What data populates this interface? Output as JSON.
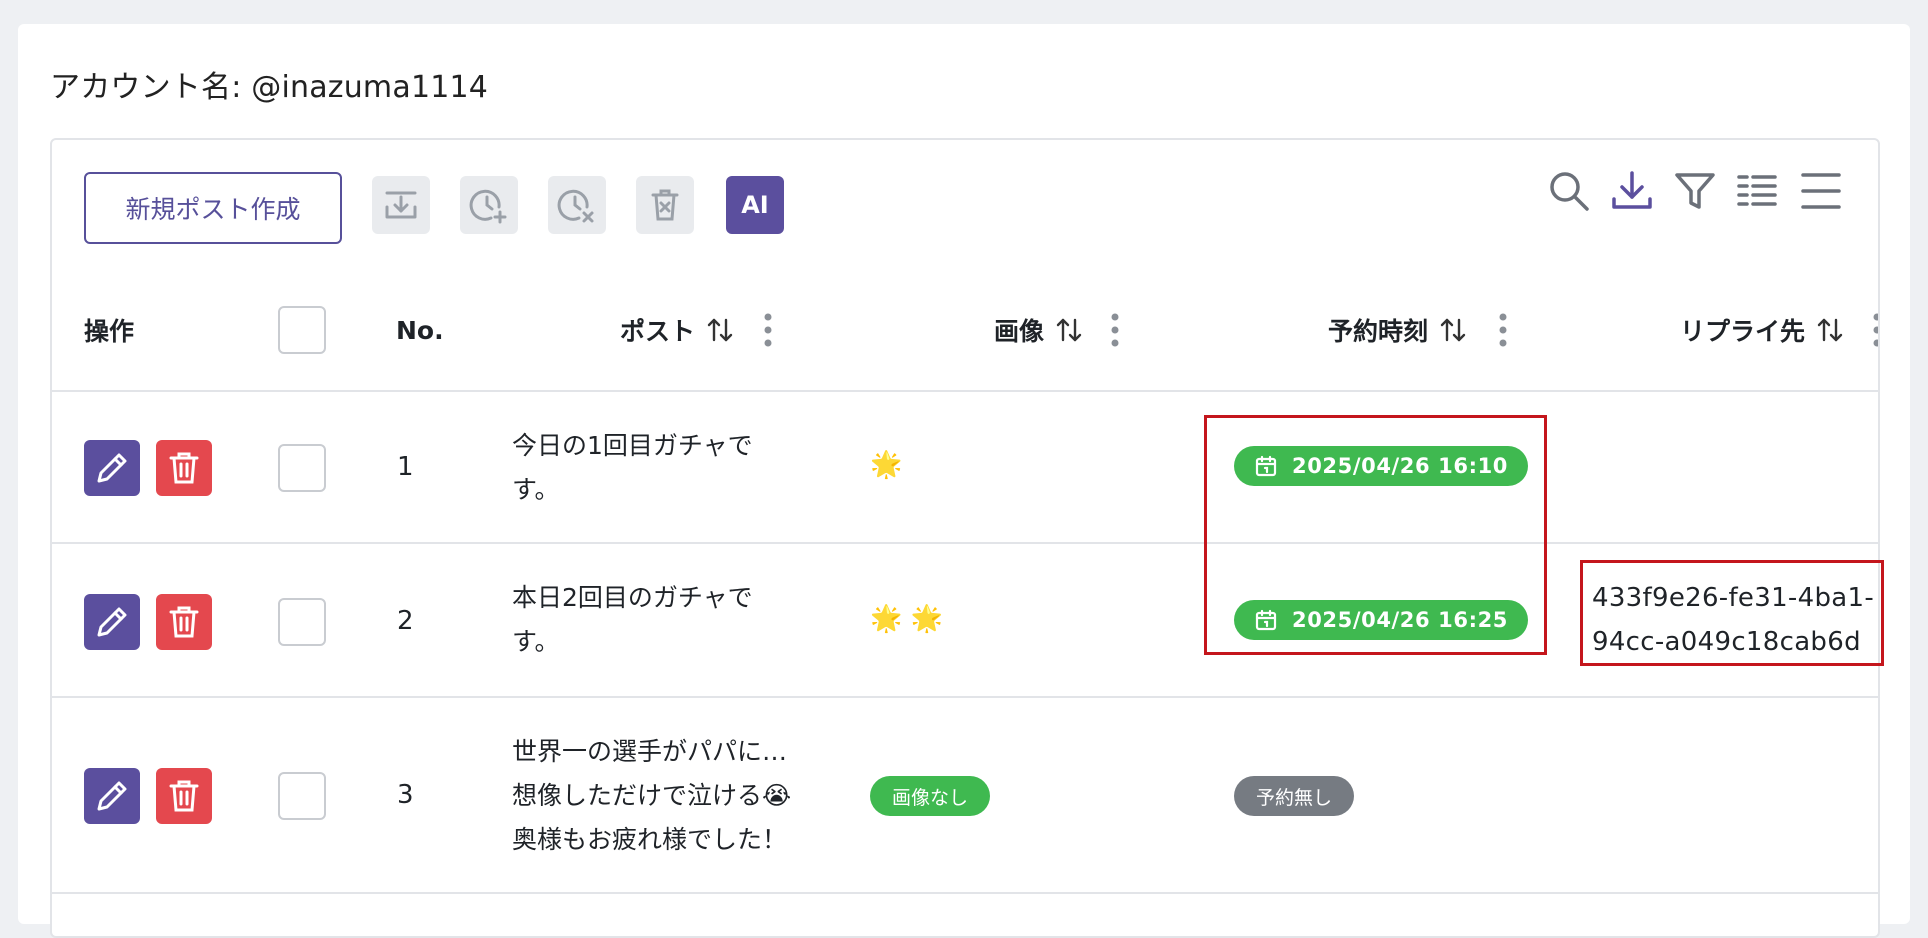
{
  "account": {
    "label": "アカウント名: @inazuma1114"
  },
  "toolbar": {
    "new_post_label": "新規ポスト作成",
    "icons": [
      "download-to-line-icon",
      "schedule-add-icon",
      "schedule-remove-icon",
      "trash-x-icon"
    ],
    "ai_label": "AI",
    "right_icons": [
      "search-icon",
      "download-icon",
      "filter-icon",
      "density-icon",
      "columns-menu-icon"
    ]
  },
  "table": {
    "columns": {
      "ops": "操作",
      "no": "No.",
      "post": "ポスト",
      "image": "画像",
      "schedule": "予約時刻",
      "reply": "リプライ先"
    },
    "rows": [
      {
        "no": "1",
        "post_line1": "今日の1回目ガチャで",
        "post_line2": "す。",
        "stars": "🌟",
        "schedule": "2025/04/26 16:10",
        "reply_line1": "",
        "reply_line2": ""
      },
      {
        "no": "2",
        "post_line1": "本日2回目のガチャで",
        "post_line2": "す。",
        "stars": "🌟 🌟",
        "schedule": "2025/04/26 16:25",
        "reply_line1": "433f9e26-fe31-4ba1-",
        "reply_line2": "94cc-a049c18cab6d"
      },
      {
        "no": "3",
        "post_line1": "世界一の選手がパパに…",
        "post_line2": "想像しただけで泣ける😭",
        "post_line3": "奥様もお疲れ様でした！",
        "image_badge": "画像なし",
        "schedule_badge": "予約無し"
      }
    ]
  },
  "colors": {
    "primary": "#5b4f9e",
    "danger": "#e4484e",
    "success": "#3fb950",
    "neutral": "#767b82",
    "highlight": "#c4161c"
  }
}
